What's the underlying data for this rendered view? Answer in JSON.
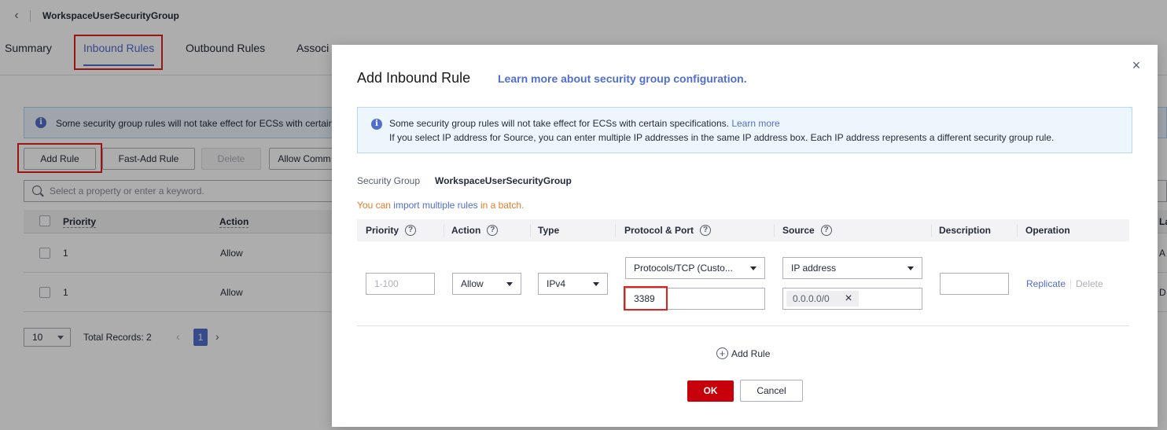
{
  "header": {
    "title": "WorkspaceUserSecurityGroup"
  },
  "tabs": [
    {
      "label": "Summary"
    },
    {
      "label": "Inbound Rules"
    },
    {
      "label": "Outbound Rules"
    },
    {
      "label": "Associ"
    }
  ],
  "bg": {
    "alert": "Some security group rules will not take effect for ECSs with certain",
    "buttons": {
      "add_rule": "Add Rule",
      "fast_add_rule": "Fast-Add Rule",
      "delete": "Delete",
      "allow_common": "Allow Comm"
    },
    "search_placeholder": "Select a property or enter a keyword.",
    "columns": {
      "priority": "Priority",
      "action": "Action"
    },
    "rows": [
      {
        "priority": "1",
        "action": "Allow",
        "right": "A"
      },
      {
        "priority": "1",
        "action": "Allow",
        "right": "D"
      }
    ],
    "right_head": "La",
    "pager": {
      "size": "10",
      "total": "Total Records: 2",
      "page": "1"
    }
  },
  "dialog": {
    "title": "Add Inbound Rule",
    "learn_link": "Learn more about security group configuration.",
    "alert_line1": "Some security group rules will not take effect for ECSs with certain specifications.",
    "alert_learn_more": "Learn more",
    "alert_line2": "If you select IP address for Source, you can enter multiple IP addresses in the same IP address box. Each IP address represents a different security group rule.",
    "security_group_label": "Security Group",
    "security_group_value": "WorkspaceUserSecurityGroup",
    "import_prefix": "You can",
    "import_link": "import multiple rules",
    "import_suffix": "in a batch.",
    "columns": {
      "priority": "Priority",
      "action": "Action",
      "type": "Type",
      "protocol_port": "Protocol & Port",
      "source": "Source",
      "description": "Description",
      "operation": "Operation"
    },
    "rule": {
      "priority_placeholder": "1-100",
      "action": "Allow",
      "type": "IPv4",
      "protocol": "Protocols/TCP (Custo...",
      "port": "3389",
      "source_type": "IP address",
      "ip_tag": "0.0.0.0/0",
      "replicate": "Replicate",
      "delete": "Delete"
    },
    "add_rule": "Add Rule",
    "ok": "OK",
    "cancel": "Cancel"
  },
  "icons": {
    "back": "chevron-left-icon",
    "info": "info-icon",
    "help": "help-icon",
    "close": "close-icon",
    "add": "plus-circle-icon"
  },
  "colors": {
    "accent": "#526ecc",
    "primary_button": "#c7000b",
    "highlight": "#e0201b",
    "warning_text": "#e37d28"
  }
}
